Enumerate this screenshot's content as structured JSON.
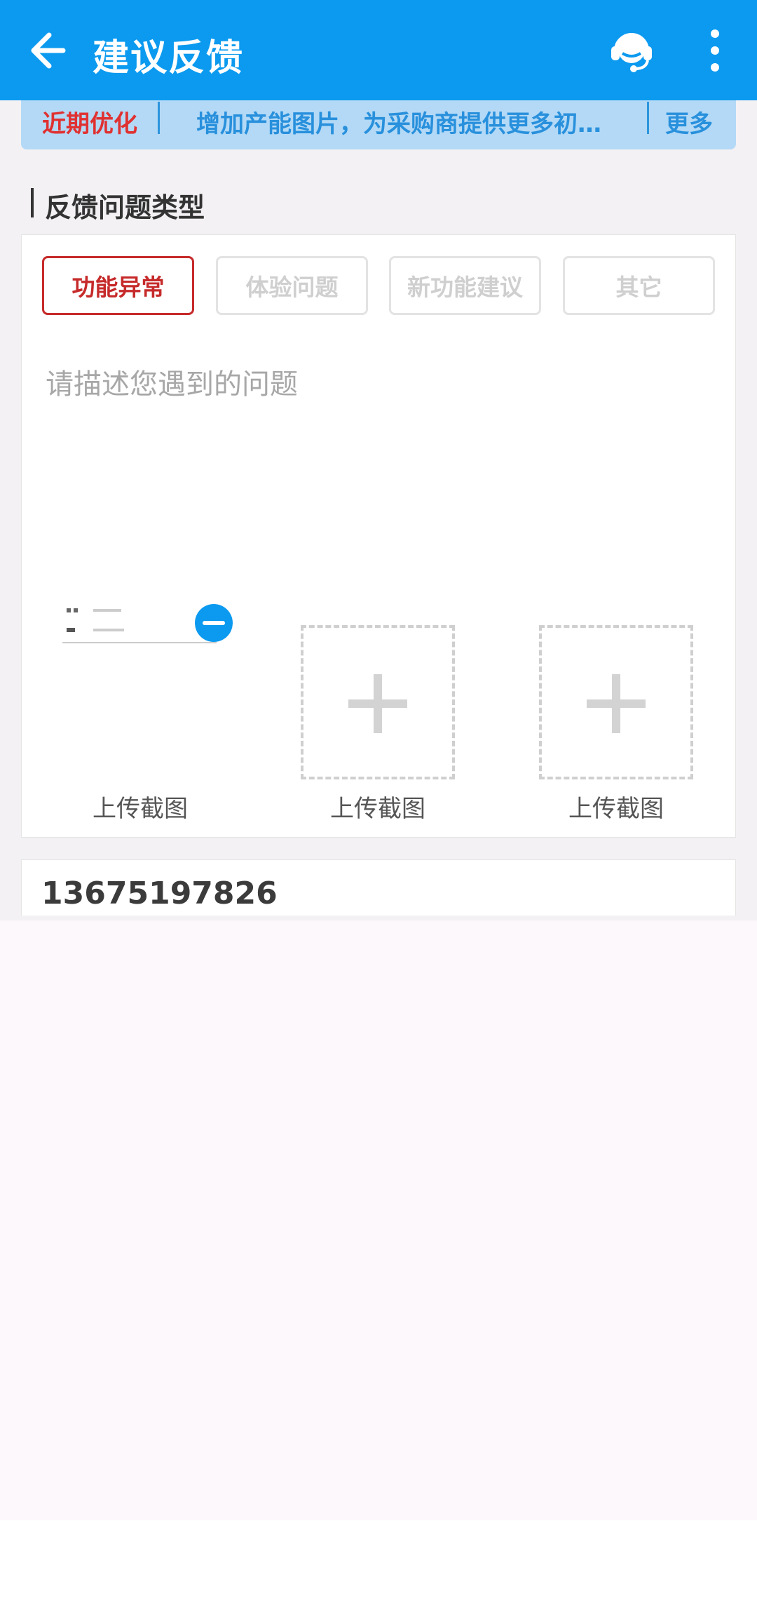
{
  "header": {
    "title": "建议反馈",
    "back_icon": "arrow-left-icon",
    "support_icon": "headset-icon",
    "more_icon": "more-vertical-icon"
  },
  "notice": {
    "tag": "近期优化",
    "text": "增加产能图片，为采购商提供更多初…",
    "more": "更多"
  },
  "section": {
    "title": "反馈问题类型"
  },
  "feedback_types": [
    {
      "label": "功能异常",
      "selected": true
    },
    {
      "label": "体验问题",
      "selected": false
    },
    {
      "label": "新功能建议",
      "selected": false
    },
    {
      "label": "其它",
      "selected": false
    }
  ],
  "description": {
    "placeholder": "请描述您遇到的问题"
  },
  "uploads": [
    {
      "label": "上传截图",
      "has_image": true
    },
    {
      "label": "上传截图",
      "has_image": false
    },
    {
      "label": "上传截图",
      "has_image": false
    }
  ],
  "contact": {
    "phone": "13675197826"
  }
}
